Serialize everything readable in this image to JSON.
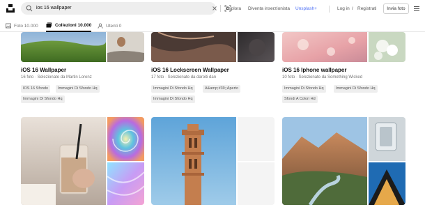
{
  "search": {
    "value": "ios 16 wallpaper"
  },
  "nav": {
    "explore": "Esplora",
    "contributor": "Diventa inserzionista",
    "unsplash_plus": "Unsplash+",
    "login": "Log in",
    "separator": "/",
    "signup": "Registrati",
    "submit_photo": "Invia foto"
  },
  "tabs": [
    {
      "label": "Foto 10.000",
      "icon": "photo-icon",
      "active": false
    },
    {
      "label": "Collezioni 10.000",
      "icon": "collection-icon",
      "active": true
    },
    {
      "label": "Utenti 0",
      "icon": "users-icon",
      "active": false
    }
  ],
  "collections": [
    {
      "title": "iOS 16 Wallpaper",
      "meta": "16 foto · Selezionate da Martin Lorenz",
      "tags": [
        "IOS 16 Sfondo",
        "Immagini Di Sfondo Hq",
        "Immagini Di Sfondo Hq"
      ]
    },
    {
      "title": "iOS 16 Lockscreen Wallpaper",
      "meta": "17 foto · Selezionate da daroiti dan",
      "tags": [
        "Immagini Di Sfondo Hq",
        "A&amp;#39;;Aperto",
        "Immagini Di Sfondo Hq"
      ]
    },
    {
      "title": "iOS 16 Iphone wallpaper",
      "meta": "10 foto · Selezionate da Something Wicked",
      "tags": [
        "Immagini Di Sfondo Hq",
        "Immagini Di Sfondo Hq",
        "Sfondi A Colori Hd"
      ]
    }
  ],
  "colors": {
    "accent": "#4b6ef5",
    "tag_bg": "#eeeeee",
    "text_muted": "#767676"
  }
}
